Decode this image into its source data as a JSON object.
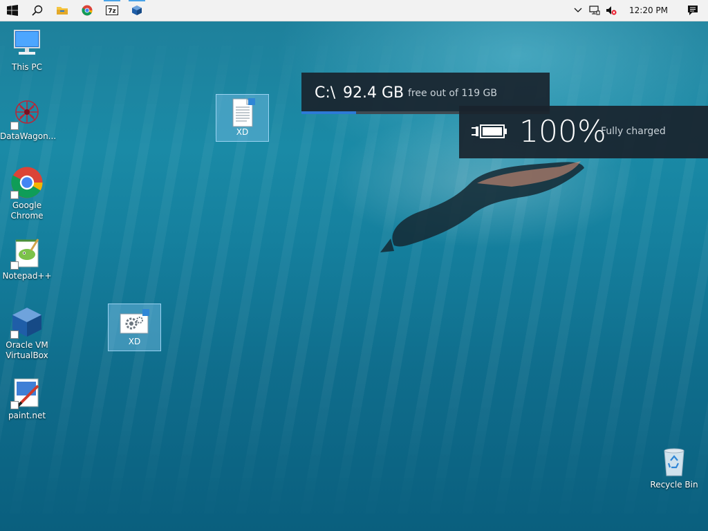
{
  "taskbar": {
    "start_icon": "windows-logo-icon",
    "pinned": [
      {
        "name": "search",
        "icon": "search-icon"
      },
      {
        "name": "file-explorer",
        "icon": "folder-icon"
      },
      {
        "name": "chrome",
        "icon": "chrome-icon"
      },
      {
        "name": "7zip",
        "icon": "7zip-icon",
        "label": "7z"
      },
      {
        "name": "virtualbox",
        "icon": "virtualbox-icon"
      }
    ],
    "tray": {
      "clock": "12:20 PM",
      "icons": [
        "chevron-up-icon",
        "network-icon",
        "volume-muted-icon"
      ],
      "notifications_icon": "action-center-icon"
    }
  },
  "desktop_icons": [
    {
      "label": "This PC",
      "icon": "computer-icon"
    },
    {
      "label": "DataWagon...",
      "icon": "datawagon-icon"
    },
    {
      "label": "Google Chrome",
      "icon": "chrome-icon"
    },
    {
      "label": "Notepad++",
      "icon": "notepadpp-icon"
    },
    {
      "label": "Oracle VM VirtualBox",
      "icon": "virtualbox-icon"
    },
    {
      "label": "paint.net",
      "icon": "paintnet-icon"
    },
    {
      "label": "Recycle Bin",
      "icon": "recycle-bin-icon"
    }
  ],
  "selected_items": [
    {
      "label": "XD",
      "icon": "text-file-icon"
    },
    {
      "label": "XD",
      "icon": "settings-file-icon"
    }
  ],
  "disk_overlay": {
    "drive": "C:\\",
    "free": "92.4 GB",
    "description": "free out of 119 GB",
    "used_fraction": 0.22,
    "accent": "#2d7ad6"
  },
  "battery_overlay": {
    "percent": "100%",
    "status": "Fully charged",
    "icon": "battery-charging-icon"
  }
}
